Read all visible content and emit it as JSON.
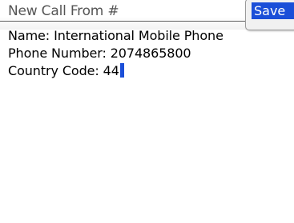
{
  "title_bar": {
    "title": "New Call From #"
  },
  "menu": {
    "save_label": "Save"
  },
  "fields": [
    {
      "text": "Name: International Mobile Phone"
    },
    {
      "text": "Phone Number: 2074865800"
    },
    {
      "text": "Country Code: 44"
    }
  ],
  "colors": {
    "accent": "#1b4fd8",
    "title_text": "#555555",
    "body_text": "#000000",
    "background": "#ffffff"
  }
}
